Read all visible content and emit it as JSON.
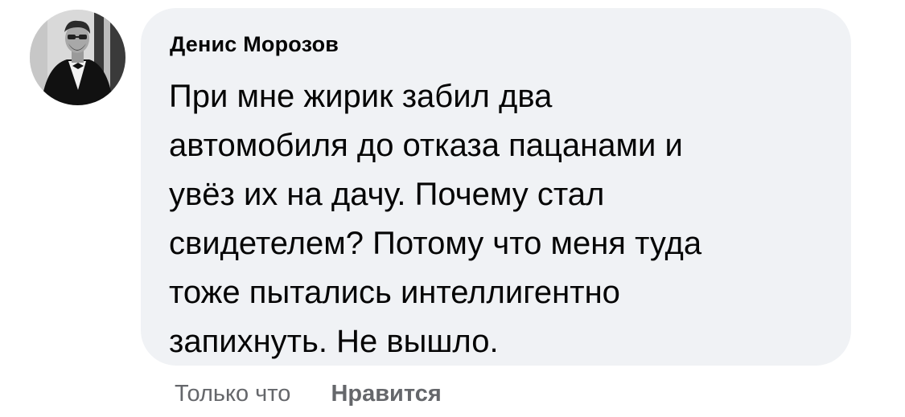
{
  "comment": {
    "author": "Денис Морозов",
    "text_lines": [
      "При мне жирик забил два",
      "автомобиля до отказа пацанами и",
      "увёз их на дачу. Почему стал",
      "свидетелем? Потому что меня туда",
      "тоже пытались интеллигентно",
      "запихнуть. Не вышло."
    ],
    "timestamp": "Только что",
    "like_label": "Нравится"
  },
  "colors": {
    "bubble_bg": "#f0f2f5",
    "text": "#050505",
    "meta_text": "#65676b"
  },
  "icons": {
    "avatar": "profile-photo-man-in-tuxedo"
  }
}
